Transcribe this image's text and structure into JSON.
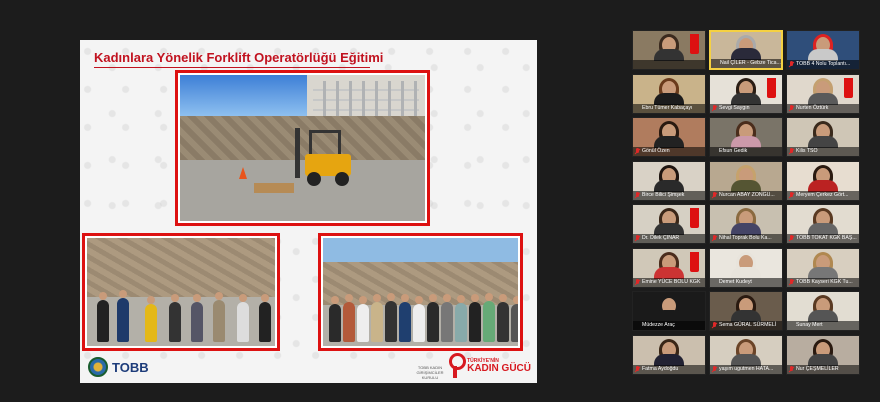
{
  "slide": {
    "title": "Kadınlara Yönelik Forklift Operatörlüğü Eğitimi",
    "tobb_logo_text": "TOBB",
    "tobb_subtitle": "TOBB KADIN GİRİŞİMCİLER KURULU",
    "kg_small": "TÜRKİYE'NİN",
    "kg_big": "KADIN GÜCÜ"
  },
  "participants": [
    {
      "name": "",
      "muted": false,
      "bg": "#8a7a62",
      "hair": "#3b2a1e",
      "torso": "#333",
      "flag": true
    },
    {
      "name": "Nail ÇİLER - Gebze Tica...",
      "muted": false,
      "active": true,
      "bg": "#c9b79a",
      "hair": "#aaa",
      "torso": "#2a2a3a",
      "flag": false
    },
    {
      "name": "TOBB 4 Nolu Toplantı...",
      "muted": true,
      "bg": "#2f4e7a",
      "hair": "#d22",
      "torso": "#c9c9c9",
      "flag": false
    },
    {
      "name": "Ebru Tümer Kabaçayı",
      "muted": false,
      "bg": "#c9b38a",
      "hair": "#6a3b1c",
      "torso": "#1c1c1c",
      "flag": false
    },
    {
      "name": "Sevgi Saygın",
      "muted": true,
      "bg": "#e6e1d8",
      "hair": "#2a1d14",
      "torso": "#333",
      "flag": true
    },
    {
      "name": "Nurten Öztürk",
      "muted": true,
      "bg": "#e0d8cc",
      "hair": "#c4a070",
      "torso": "#5a5a5a",
      "flag": true
    },
    {
      "name": "Gönül Özen",
      "muted": true,
      "bg": "#b07c5e",
      "hair": "#2a1a10",
      "torso": "#222",
      "flag": false
    },
    {
      "name": "Efsun Gedik",
      "muted": false,
      "bg": "#7a7468",
      "hair": "#4a2d1c",
      "torso": "#c9a",
      "flag": false
    },
    {
      "name": "Kilis TSO",
      "muted": true,
      "bg": "#cfc6b6",
      "hair": "#3a2a1c",
      "torso": "#444",
      "flag": false
    },
    {
      "name": "Birce Bilici Şimşek",
      "muted": true,
      "bg": "#d9d2c6",
      "hair": "#1f1510",
      "torso": "#2a2a2a",
      "flag": false
    },
    {
      "name": "Nurcan ABAY ZONGU...",
      "muted": true,
      "bg": "#b8a890",
      "hair": "#c6a26c",
      "torso": "#553",
      "flag": false
    },
    {
      "name": "Meryem Çerkez Gört...",
      "muted": true,
      "bg": "#e7ddd0",
      "hair": "#2a1a10",
      "torso": "#b22",
      "flag": false
    },
    {
      "name": "Dr. Dilek ÇINAR",
      "muted": true,
      "bg": "#d6d0c4",
      "hair": "#3a2618",
      "torso": "#333",
      "flag": true
    },
    {
      "name": "Nihal Toprak Bolu Ka...",
      "muted": true,
      "bg": "#c8c0b0",
      "hair": "#8a6a40",
      "torso": "#446",
      "flag": false
    },
    {
      "name": "TOBB TOKAT KGK BAŞ...",
      "muted": true,
      "bg": "#e2dcd0",
      "hair": "#5a3a22",
      "torso": "#666",
      "flag": false
    },
    {
      "name": "Emine YÜCE BOLU KGK",
      "muted": true,
      "bg": "#d0c8b8",
      "hair": "#4a2c1c",
      "torso": "#c33",
      "flag": true
    },
    {
      "name": "Demet Kudeyt",
      "muted": false,
      "bg": "#eae6de",
      "hair": "#e8e4dc",
      "torso": "#e8e4dc",
      "flag": false
    },
    {
      "name": "TOBB Kayseri KGK Tu...",
      "muted": true,
      "bg": "#d8cfc0",
      "hair": "#b08850",
      "torso": "#777",
      "flag": false
    },
    {
      "name": "Müdezze Araç",
      "muted": false,
      "bg": "#1a1a1a",
      "hair": "#1a1a1a",
      "torso": "#1a1a1a",
      "flag": false
    },
    {
      "name": "Sema GÜRAL SÜRMELİ",
      "muted": true,
      "bg": "#6a5c4c",
      "hair": "#2a1a10",
      "torso": "#333",
      "flag": false
    },
    {
      "name": "Sunay Mert",
      "muted": false,
      "bg": "#e2ddd2",
      "hair": "#5a3a22",
      "torso": "#555",
      "flag": false
    },
    {
      "name": "Fatma Aydoğdu",
      "muted": true,
      "bg": "#cbbfae",
      "hair": "#3a2616",
      "torso": "#223",
      "flag": false
    },
    {
      "name": "yaşım ugutmen HATA...",
      "muted": true,
      "bg": "#d6cec0",
      "hair": "#6a4428",
      "torso": "#555",
      "flag": false
    },
    {
      "name": "Nur ÇEŞMELİLER",
      "muted": true,
      "bg": "#b8ada0",
      "hair": "#2a1a10",
      "torso": "#444",
      "flag": false
    }
  ]
}
